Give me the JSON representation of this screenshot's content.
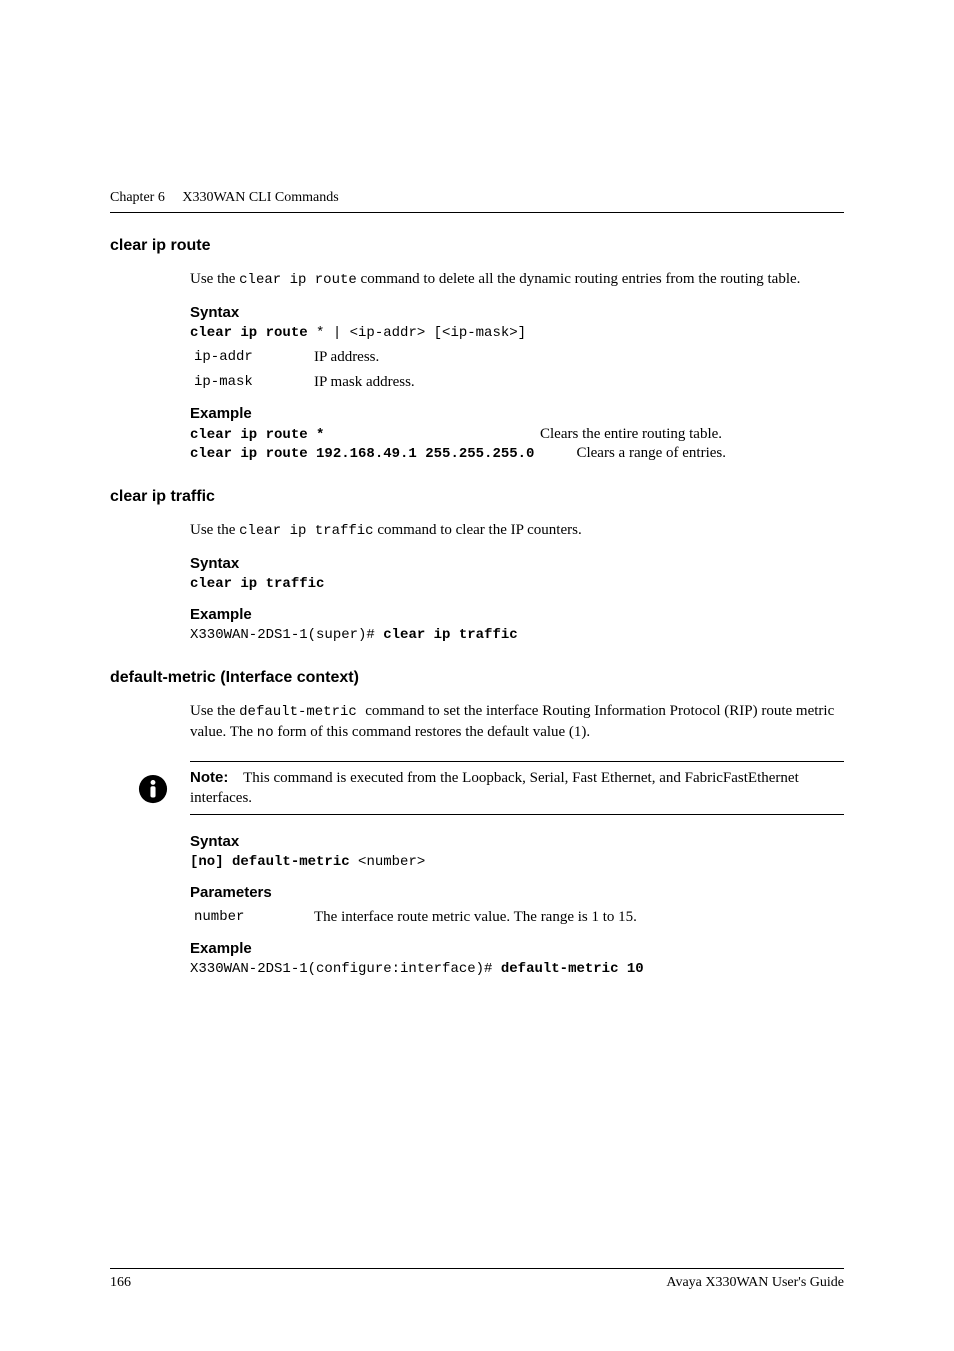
{
  "header": {
    "chapter": "Chapter 6",
    "title": "X330WAN CLI Commands"
  },
  "sections": {
    "clear_ip_route": {
      "title": "clear ip route",
      "intro_before_code": "Use the ",
      "intro_code": "clear ip route",
      "intro_after_code": " command to delete all the dynamic routing entries from the routing table.",
      "syntax_label": "Syntax",
      "syntax_cmd_bold": "clear ip route",
      "syntax_cmd_rest": " * | <ip-addr> [<ip-mask>]",
      "params": [
        {
          "name": "ip-addr",
          "desc": "IP address."
        },
        {
          "name": "ip-mask",
          "desc": "IP mask address."
        }
      ],
      "example_label": "Example",
      "examples": [
        {
          "cmd": "clear ip route *",
          "desc": "Clears the entire routing table."
        },
        {
          "cmd": "clear ip route 192.168.49.1 255.255.255.0",
          "desc": "Clears a range of entries."
        }
      ]
    },
    "clear_ip_traffic": {
      "title": "clear ip traffic",
      "intro_before_code": "Use the ",
      "intro_code": "clear ip traffic",
      "intro_after_code": " command to clear the IP counters.",
      "syntax_label": "Syntax",
      "syntax_cmd": "clear ip traffic",
      "example_label": "Example",
      "example_prompt": "X330WAN-2DS1-1(super)# ",
      "example_bold": "clear ip traffic"
    },
    "default_metric": {
      "title": "default-metric (Interface context)",
      "intro_p1_before": "Use the ",
      "intro_p1_code1": " default-metric ",
      "intro_p1_mid": "command to set the interface Routing Information Protocol (RIP) route metric value. The ",
      "intro_p1_code2": "no",
      "intro_p1_after": " form of this command restores the default value (1).",
      "note_label": "Note:",
      "note_text": "This command is executed from the Loopback, Serial, Fast Ethernet, and FabricFastEthernet interfaces.",
      "syntax_label": "Syntax",
      "syntax_cmd_bold": "[no] default-metric",
      "syntax_cmd_rest": " <number>",
      "parameters_label": "Parameters",
      "params": [
        {
          "name": "number",
          "desc": "The interface route metric value. The range is 1 to 15."
        }
      ],
      "example_label": "Example",
      "example_prompt": "X330WAN-2DS1-1(configure:interface)# ",
      "example_bold": "default-metric 10"
    }
  },
  "footer": {
    "page": "166",
    "guide": "Avaya X330WAN User's Guide"
  }
}
